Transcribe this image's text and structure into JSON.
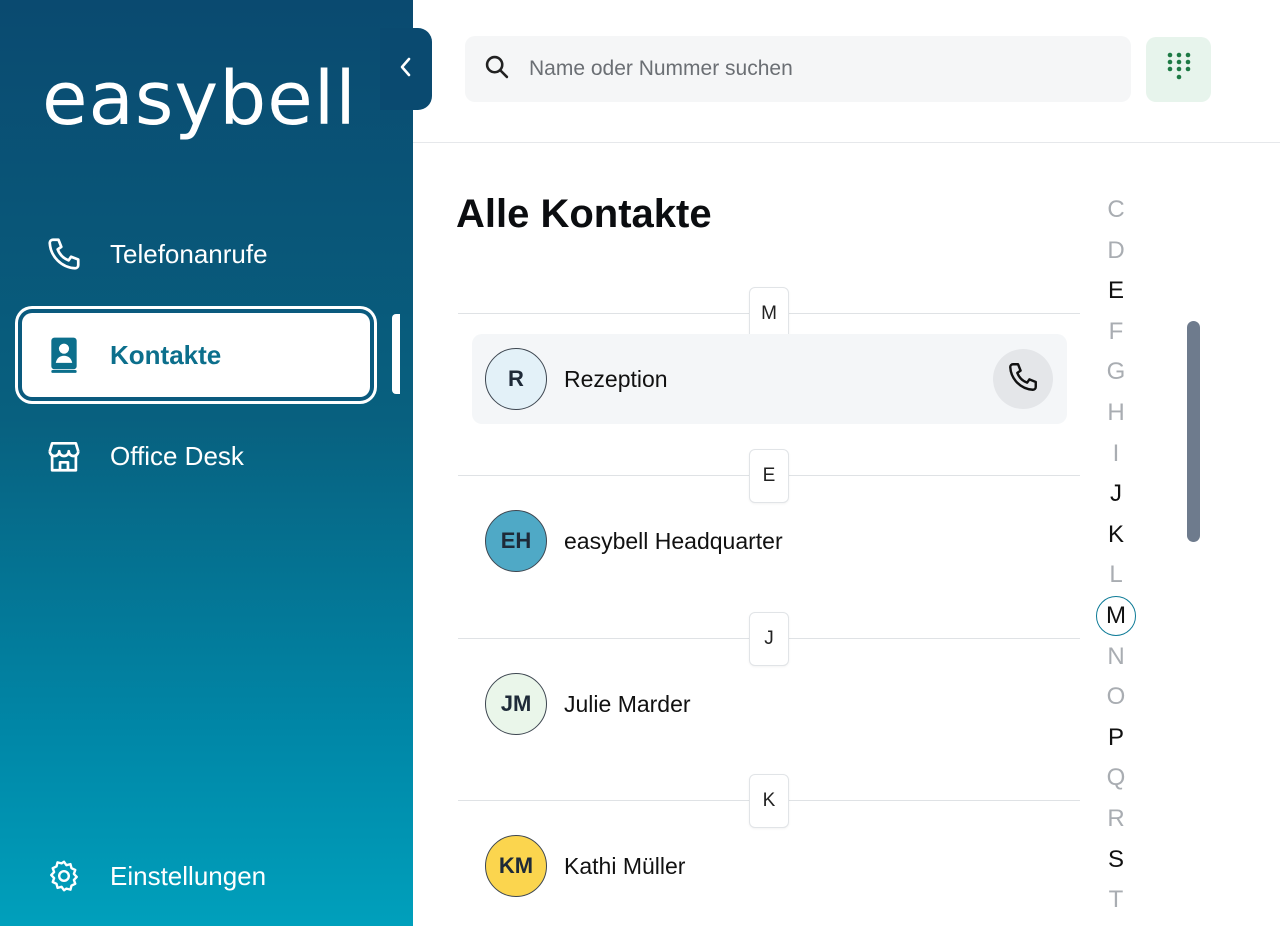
{
  "sidebar": {
    "logo": "easybell",
    "items": [
      {
        "label": "Telefonanrufe",
        "icon": "phone-icon",
        "active": false
      },
      {
        "label": "Kontakte",
        "icon": "contact-book-icon",
        "active": true
      },
      {
        "label": "Office Desk",
        "icon": "store-icon",
        "active": false
      }
    ],
    "settings_label": "Einstellungen",
    "collapse_icon": "chevron-left-icon"
  },
  "search": {
    "placeholder": "Name oder Nummer suchen",
    "value": ""
  },
  "dialpad_icon": "dialpad-icon",
  "main": {
    "title": "Alle Kontakte",
    "sections": [
      {
        "letter": "M",
        "contacts": [
          {
            "initials": "R",
            "name": "Rezeption",
            "avatar_color": "#e3f1f8",
            "highlighted": true
          }
        ]
      },
      {
        "letter": "E",
        "contacts": [
          {
            "initials": "EH",
            "name": "easybell Headquarter",
            "avatar_color": "#4fa9c6",
            "highlighted": false
          }
        ]
      },
      {
        "letter": "J",
        "contacts": [
          {
            "initials": "JM",
            "name": "Julie Marder",
            "avatar_color": "#eaf6ea",
            "highlighted": false
          }
        ]
      },
      {
        "letter": "K",
        "contacts": [
          {
            "initials": "KM",
            "name": "Kathi Müller",
            "avatar_color": "#fbd54e",
            "highlighted": false
          }
        ]
      }
    ]
  },
  "alphabet": [
    {
      "letter": "C",
      "state": "disabled"
    },
    {
      "letter": "D",
      "state": "disabled"
    },
    {
      "letter": "E",
      "state": "available"
    },
    {
      "letter": "F",
      "state": "disabled"
    },
    {
      "letter": "G",
      "state": "disabled"
    },
    {
      "letter": "H",
      "state": "disabled"
    },
    {
      "letter": "I",
      "state": "disabled"
    },
    {
      "letter": "J",
      "state": "available"
    },
    {
      "letter": "K",
      "state": "available"
    },
    {
      "letter": "L",
      "state": "disabled"
    },
    {
      "letter": "M",
      "state": "current"
    },
    {
      "letter": "N",
      "state": "disabled"
    },
    {
      "letter": "O",
      "state": "disabled"
    },
    {
      "letter": "P",
      "state": "available"
    },
    {
      "letter": "Q",
      "state": "disabled"
    },
    {
      "letter": "R",
      "state": "disabled"
    },
    {
      "letter": "S",
      "state": "available"
    },
    {
      "letter": "T",
      "state": "disabled"
    }
  ],
  "colors": {
    "sidebar_top": "#0a4a70",
    "sidebar_bottom": "#00a0bc",
    "accent": "#0c6f8c",
    "dialpad_green": "#1e7a45"
  }
}
